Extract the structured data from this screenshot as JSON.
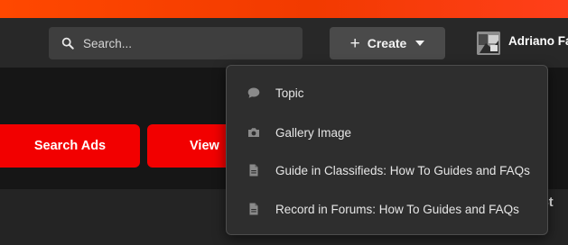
{
  "header": {
    "search_placeholder": "Search...",
    "create_label": "Create",
    "user_name": "Adriano Fa"
  },
  "actions": {
    "search_ads_label": "Search Ads",
    "view_label": "View"
  },
  "section": {
    "partial_title": "s St"
  },
  "create_menu": {
    "items": [
      {
        "label": "Topic",
        "icon": "chat-bubble-icon"
      },
      {
        "label": "Gallery Image",
        "icon": "camera-icon"
      },
      {
        "label": "Guide in Classifieds: How To Guides and FAQs",
        "icon": "document-icon"
      },
      {
        "label": "Record in Forums: How To Guides and FAQs",
        "icon": "document-icon"
      }
    ]
  },
  "colors": {
    "accent_red": "#f20000",
    "top_stripe": "#ff4800",
    "menu_bg": "#2e2e2e"
  }
}
